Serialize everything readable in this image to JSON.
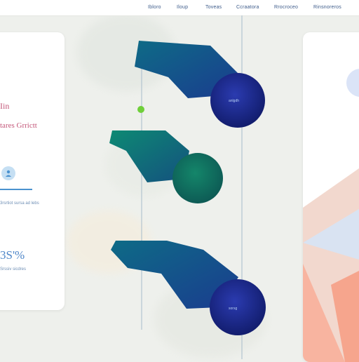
{
  "nav": {
    "items": [
      {
        "label": "Ibloro"
      },
      {
        "label": "Iloup"
      },
      {
        "label": "Toveas"
      },
      {
        "label": "Ccraatora"
      },
      {
        "label": "Rrocroceo"
      },
      {
        "label": "Rinsnoreros"
      }
    ]
  },
  "left_card": {
    "heading_short": "Iin",
    "heading_long": "tares Grrictt",
    "caption": "3rsrtiot sursa ad lebs",
    "stat_value": "3S'%",
    "stat_caption": "Srssiv sicdres"
  },
  "flow": {
    "nodes": [
      {
        "label": "anlgdh"
      },
      {
        "label": ""
      },
      {
        "label": "sorsg"
      }
    ]
  },
  "colors": {
    "accent_blue": "#4a92cf",
    "node_navy": "#1f2b8e",
    "node_teal": "#0f7c6b",
    "connector_green": "#6fcf3a",
    "heading_pink": "#c4587a"
  },
  "icons": [
    "user-circle-icon"
  ]
}
